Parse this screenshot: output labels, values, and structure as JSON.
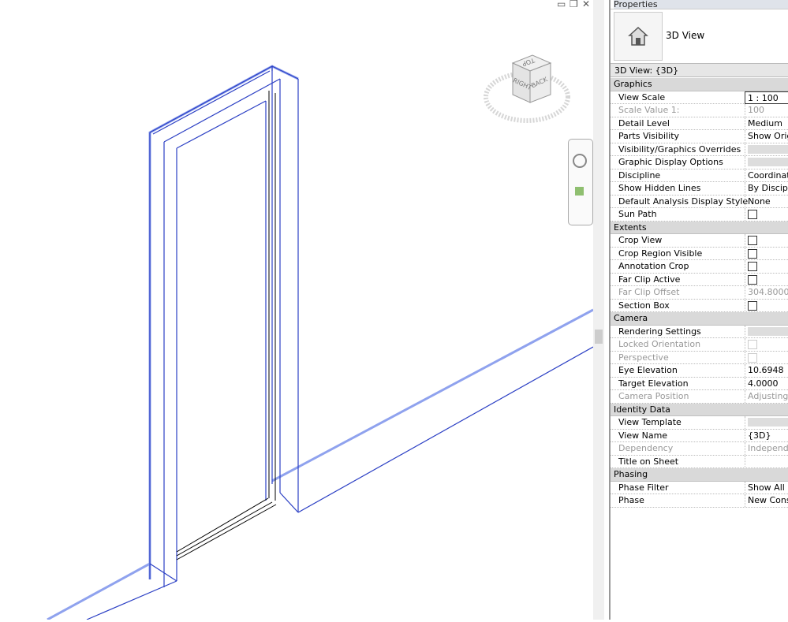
{
  "properties": {
    "title": "Properties",
    "type_name": "3D View",
    "instance_selector": "3D View: {3D}",
    "rows": [
      {
        "kind": "section",
        "label": "Graphics"
      },
      {
        "label": "View Scale",
        "value": "1 : 100",
        "style": "boxed"
      },
      {
        "label": "Scale Value    1:",
        "value": "100",
        "disabled": true
      },
      {
        "label": "Detail Level",
        "value": "Medium"
      },
      {
        "label": "Parts Visibility",
        "value": "Show Original"
      },
      {
        "label": "Visibility/Graphics Overrides",
        "control": "button"
      },
      {
        "label": "Graphic Display Options",
        "control": "button"
      },
      {
        "label": "Discipline",
        "value": "Coordination"
      },
      {
        "label": "Show Hidden Lines",
        "value": "By Discipline"
      },
      {
        "label": "Default Analysis Display Style",
        "value": "None"
      },
      {
        "label": "Sun Path",
        "control": "checkbox",
        "checked": false
      },
      {
        "kind": "section",
        "label": "Extents"
      },
      {
        "label": "Crop View",
        "control": "checkbox",
        "checked": false
      },
      {
        "label": "Crop Region Visible",
        "control": "checkbox",
        "checked": false
      },
      {
        "label": "Annotation Crop",
        "control": "checkbox",
        "checked": false
      },
      {
        "label": "Far Clip Active",
        "control": "checkbox",
        "checked": false
      },
      {
        "label": "Far Clip Offset",
        "value": "304.8000",
        "disabled": true
      },
      {
        "label": "Section Box",
        "control": "checkbox",
        "checked": false
      },
      {
        "kind": "section",
        "label": "Camera"
      },
      {
        "label": "Rendering Settings",
        "control": "button"
      },
      {
        "label": "Locked Orientation",
        "control": "checkbox",
        "checked": false,
        "disabled": true
      },
      {
        "label": "Perspective",
        "control": "checkbox",
        "checked": false,
        "disabled": true
      },
      {
        "label": "Eye Elevation",
        "value": "10.6948"
      },
      {
        "label": "Target Elevation",
        "value": "4.0000"
      },
      {
        "label": "Camera Position",
        "value": "Adjusting",
        "disabled": true
      },
      {
        "kind": "section",
        "label": "Identity Data"
      },
      {
        "label": "View Template",
        "control": "button"
      },
      {
        "label": "View Name",
        "value": "{3D}"
      },
      {
        "label": "Dependency",
        "value": "Independent",
        "disabled": true
      },
      {
        "label": "Title on Sheet",
        "value": ""
      },
      {
        "kind": "section",
        "label": "Phasing"
      },
      {
        "label": "Phase Filter",
        "value": "Show All"
      },
      {
        "label": "Phase",
        "value": "New Construction"
      }
    ]
  },
  "viewcube": {
    "top": "TOP",
    "right": "RIGHT",
    "back": "BACK"
  },
  "colors": {
    "model_line": "#3a4fd0",
    "model_halo": "#8fa2ee",
    "section_bg": "#d9d9d9"
  }
}
